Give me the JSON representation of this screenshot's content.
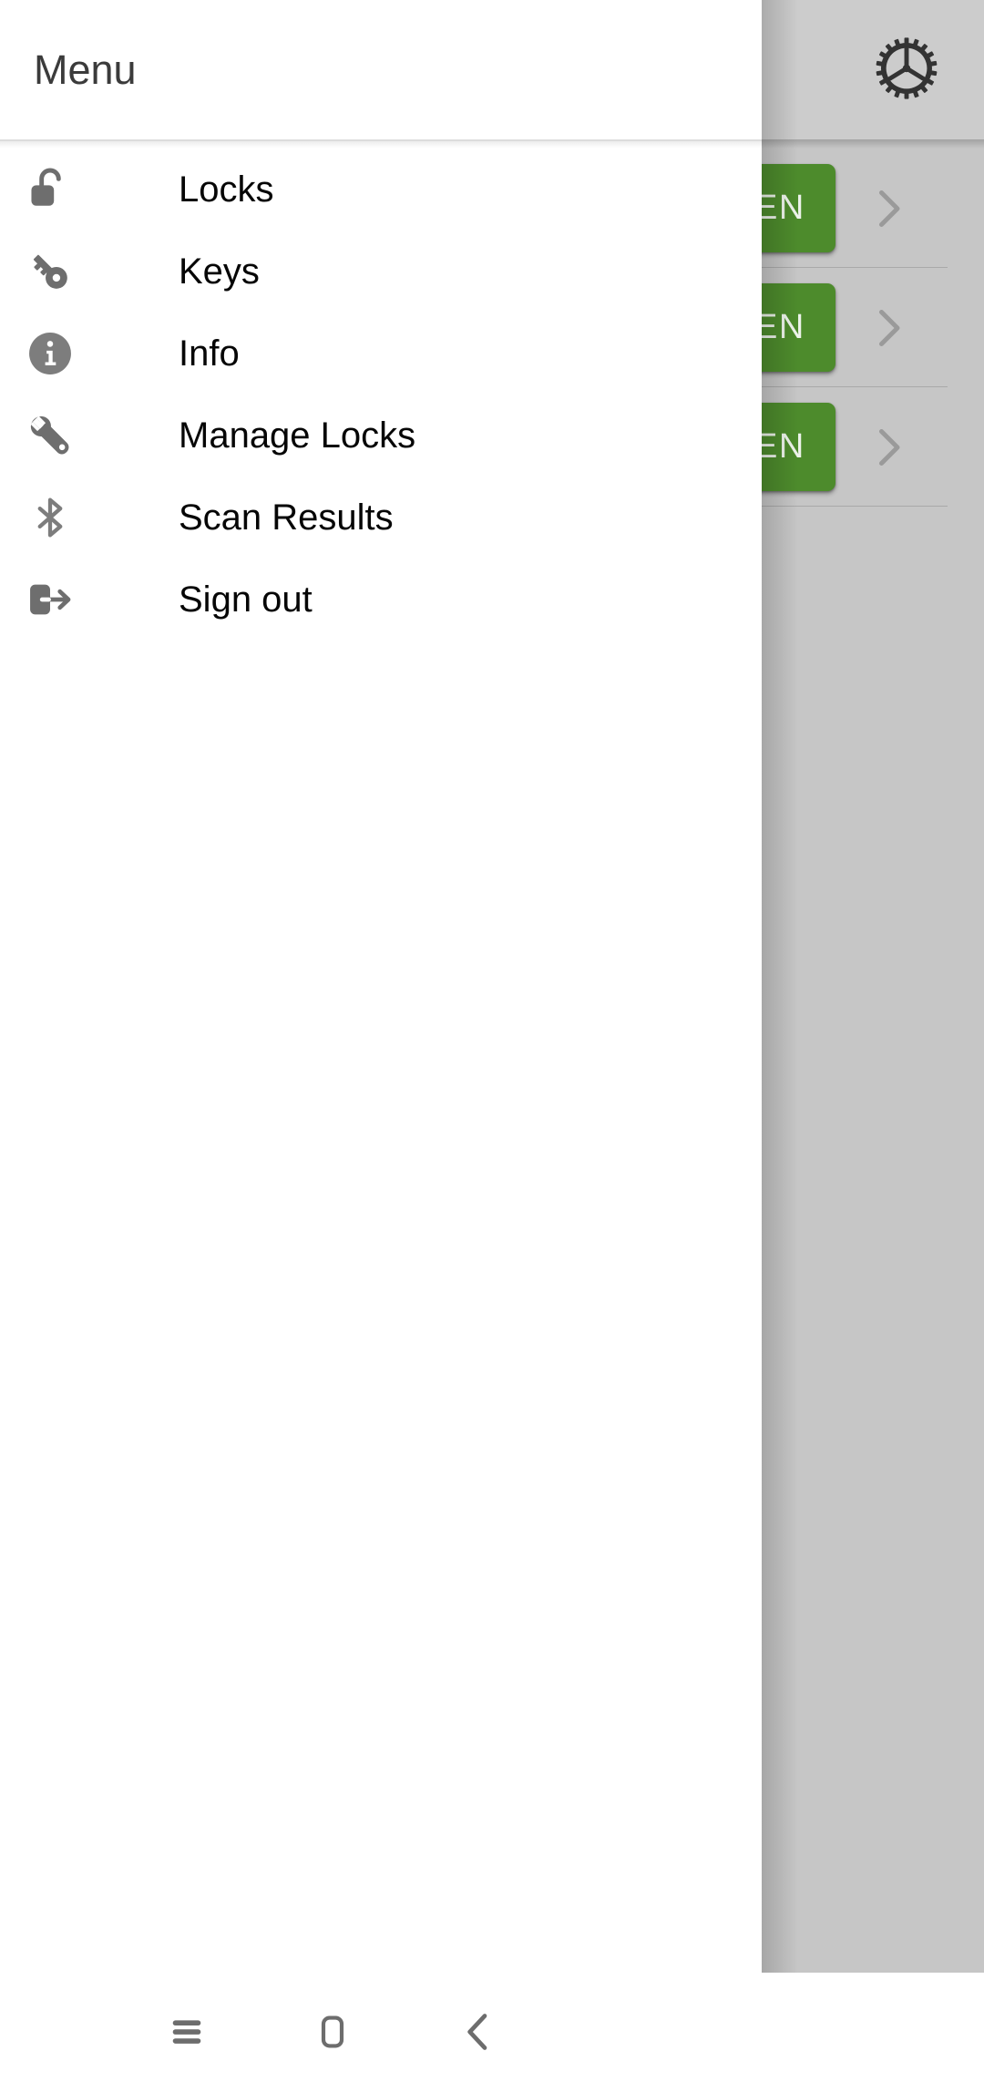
{
  "app": {
    "appbar": {
      "settings_icon": "gear-icon"
    },
    "lock_list": [
      {
        "open_label": "OPEN",
        "chevron_icon": "chevron-right-icon"
      },
      {
        "open_label": "OPEN",
        "chevron_icon": "chevron-right-icon"
      },
      {
        "open_label": "OPEN",
        "chevron_icon": "chevron-right-icon"
      }
    ],
    "accent_green": "#4d8b2c",
    "scrim_color": "#c6c6c6"
  },
  "drawer": {
    "title": "Menu",
    "items": [
      {
        "label": "Locks",
        "icon": "unlocked-padlock-icon"
      },
      {
        "label": "Keys",
        "icon": "key-icon"
      },
      {
        "label": "Info",
        "icon": "info-circle-icon"
      },
      {
        "label": "Manage Locks",
        "icon": "wrench-icon"
      },
      {
        "label": "Scan Results",
        "icon": "bluetooth-icon"
      },
      {
        "label": "Sign out",
        "icon": "sign-out-icon"
      }
    ]
  },
  "system_nav": {
    "recents_icon": "hamburger-menu-icon",
    "home_icon": "square-home-icon",
    "back_icon": "chevron-left-icon"
  }
}
